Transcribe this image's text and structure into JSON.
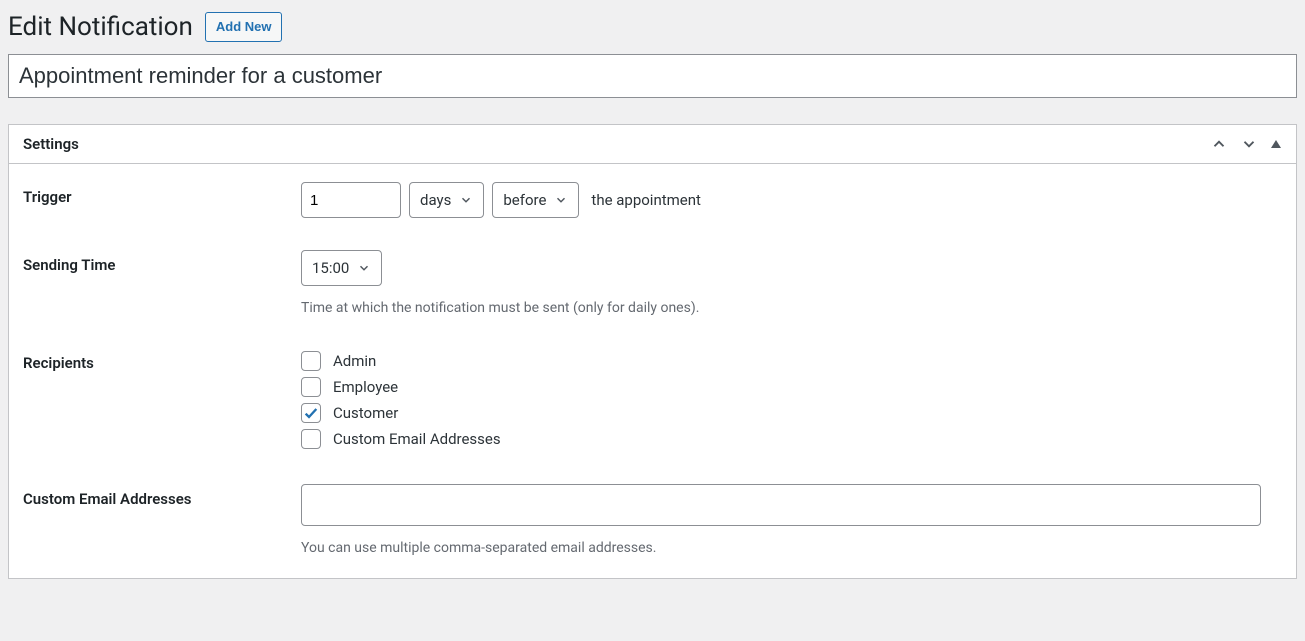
{
  "header": {
    "title": "Edit Notification",
    "add_new": "Add New"
  },
  "title_value": "Appointment reminder for a customer",
  "panel": {
    "title": "Settings",
    "trigger": {
      "label": "Trigger",
      "number": "1",
      "unit": "days",
      "relation": "before",
      "suffix": "the appointment"
    },
    "sending_time": {
      "label": "Sending Time",
      "value": "15:00",
      "help": "Time at which the notification must be sent (only for daily ones)."
    },
    "recipients": {
      "label": "Recipients",
      "options": [
        {
          "label": "Admin",
          "checked": false
        },
        {
          "label": "Employee",
          "checked": false
        },
        {
          "label": "Customer",
          "checked": true
        },
        {
          "label": "Custom Email Addresses",
          "checked": false
        }
      ]
    },
    "custom_emails": {
      "label": "Custom Email Addresses",
      "value": "",
      "help": "You can use multiple comma-separated email addresses."
    }
  }
}
